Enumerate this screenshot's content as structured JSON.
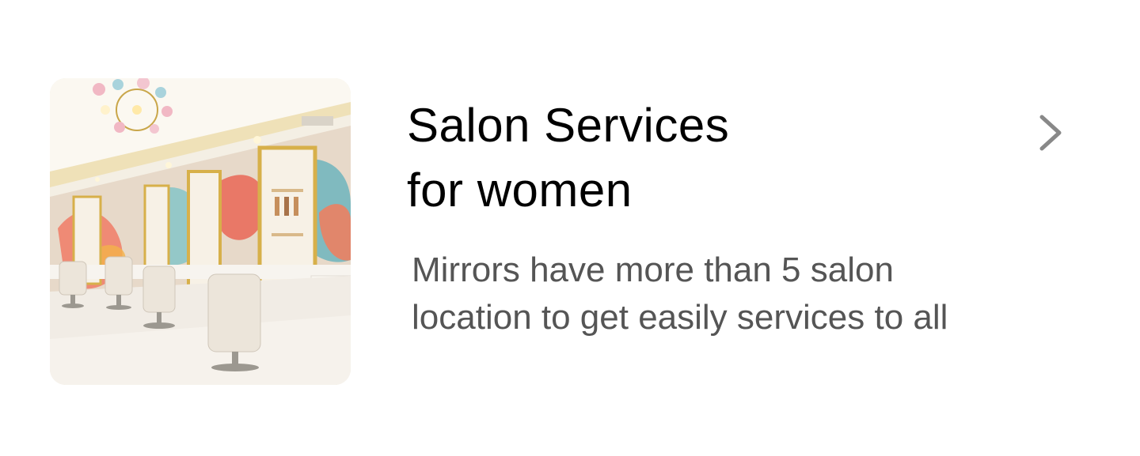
{
  "card": {
    "title_line1": "Salon Services",
    "title_line2": "for women",
    "description_line1": "Mirrors have more than 5 salon",
    "description_line2": "location to get easily services to all",
    "image_alt": "salon interior with styling chairs and mirrors",
    "chevron_icon": "chevron-right-icon"
  },
  "colors": {
    "title": "#000000",
    "description": "#555555",
    "chevron": "#888888",
    "background": "#ffffff"
  }
}
